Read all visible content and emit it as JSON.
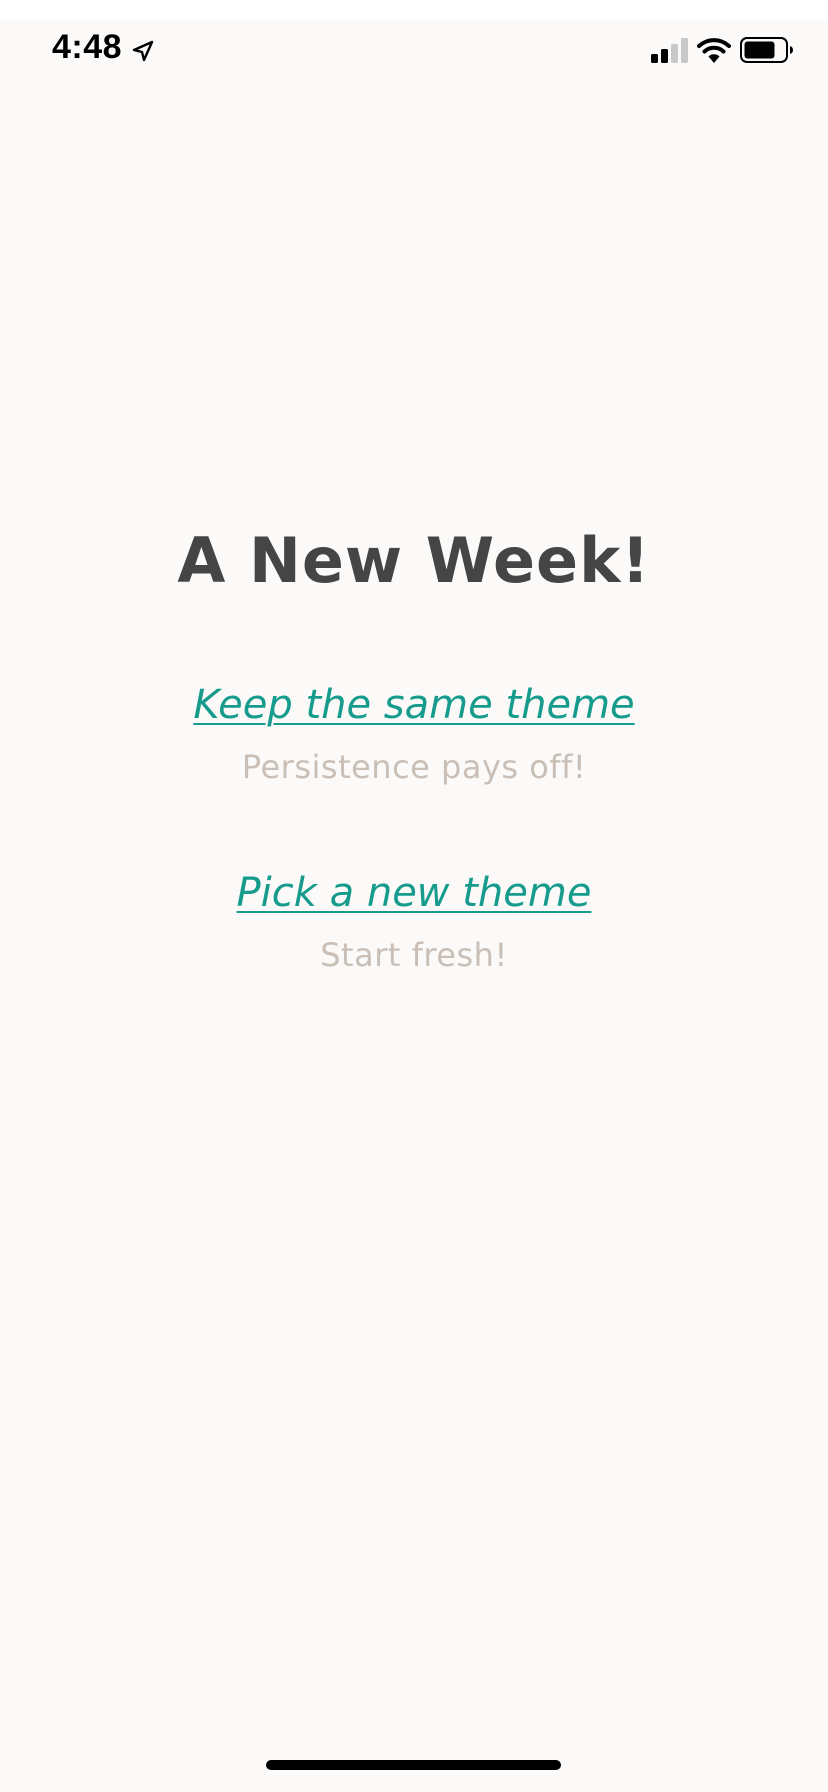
{
  "status_bar": {
    "time": "4:48",
    "location_icon": "location-arrow-icon",
    "signal_icon": "cellular-signal-icon",
    "wifi_icon": "wifi-icon",
    "battery_icon": "battery-icon"
  },
  "screen": {
    "title": "A New Week!",
    "options": [
      {
        "label": "Keep the same theme",
        "subtitle": "Persistence pays off!"
      },
      {
        "label": "Pick a new theme",
        "subtitle": "Start fresh!"
      }
    ]
  },
  "colors": {
    "background": "#fbfaf8",
    "title": "#454545",
    "link": "#169b8d",
    "subtitle": "#c9bfb6"
  }
}
